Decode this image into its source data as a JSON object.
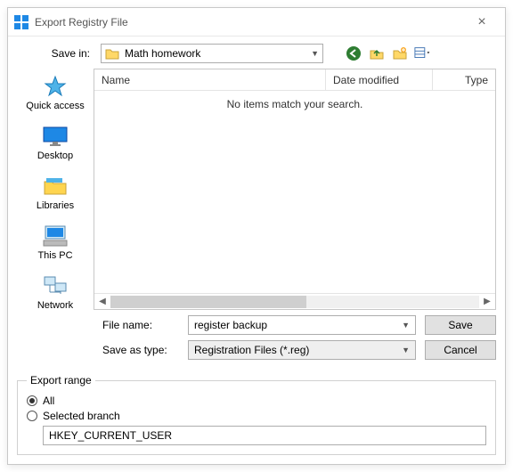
{
  "title": "Export Registry File",
  "savein": {
    "label": "Save in:",
    "value": "Math homework"
  },
  "columns": {
    "name": "Name",
    "date": "Date modified",
    "type": "Type"
  },
  "empty_message": "No items match your search.",
  "places": {
    "quick": "Quick access",
    "desktop": "Desktop",
    "libraries": "Libraries",
    "thispc": "This PC",
    "network": "Network"
  },
  "fields": {
    "filename_label": "File name:",
    "filename_value": "register backup",
    "saveastype_label": "Save as type:",
    "saveastype_value": "Registration Files (*.reg)"
  },
  "buttons": {
    "save": "Save",
    "cancel": "Cancel"
  },
  "export": {
    "legend": "Export range",
    "all": "All",
    "selected": "Selected branch",
    "branch_value": "HKEY_CURRENT_USER"
  }
}
